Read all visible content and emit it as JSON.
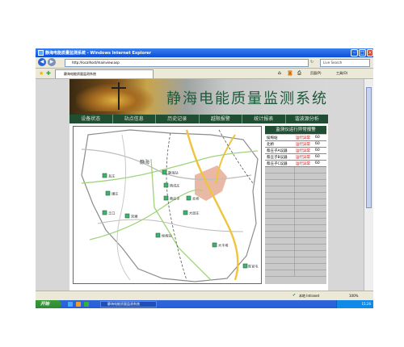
{
  "browser": {
    "title": "静海电能质量监测系统 - Windows Internet Explorer",
    "address": "http://localhost/mainview.asp",
    "tab_label": "静海电能质量监测系统",
    "search_placeholder": "Live Search",
    "toolbar_page": "页面(P)",
    "toolbar_tools": "工具(O)",
    "status_text": "本地 Intranet",
    "zoom": "100%"
  },
  "page": {
    "title": "静海电能质量监测系统",
    "menu": [
      "设备状态",
      "站点信息",
      "历史记录",
      "越限报警",
      "统计报表",
      "谐波源分析"
    ]
  },
  "alarm_panel": {
    "header": "监测仪运行异常报警",
    "rows": [
      {
        "name": "侯峋站",
        "status": "运行异常",
        "value": "60"
      },
      {
        "name": "北桥",
        "status": "运行异常",
        "value": "60"
      },
      {
        "name": "蔡庄子A议器",
        "status": "运行异常",
        "value": "60"
      },
      {
        "name": "蔡庄子B议器",
        "status": "运行异常",
        "value": "60"
      },
      {
        "name": "蔡庄子C议器",
        "status": "运行异常",
        "value": "60"
      }
    ]
  },
  "map": {
    "city_label": "静海",
    "stations": [
      {
        "label": "静海站"
      },
      {
        "label": "蔡庄子"
      },
      {
        "label": "北桥"
      },
      {
        "label": "瓦庄"
      },
      {
        "label": "谦庄"
      },
      {
        "label": "王口"
      },
      {
        "label": "双塘"
      },
      {
        "label": "大邱庄"
      },
      {
        "label": "侯峋站"
      },
      {
        "label": "大丰堆"
      },
      {
        "label": "杨成庄"
      },
      {
        "label": "陈官屯"
      }
    ]
  },
  "taskbar": {
    "start_label": "开始",
    "task_item": "静海电能质量监测系统",
    "clock": "15:26"
  },
  "colors": {
    "brand_green": "#1f4e33",
    "alarm_red": "#d00000",
    "station_green": "#3bb56b",
    "road_yellow": "#f0c43a"
  }
}
